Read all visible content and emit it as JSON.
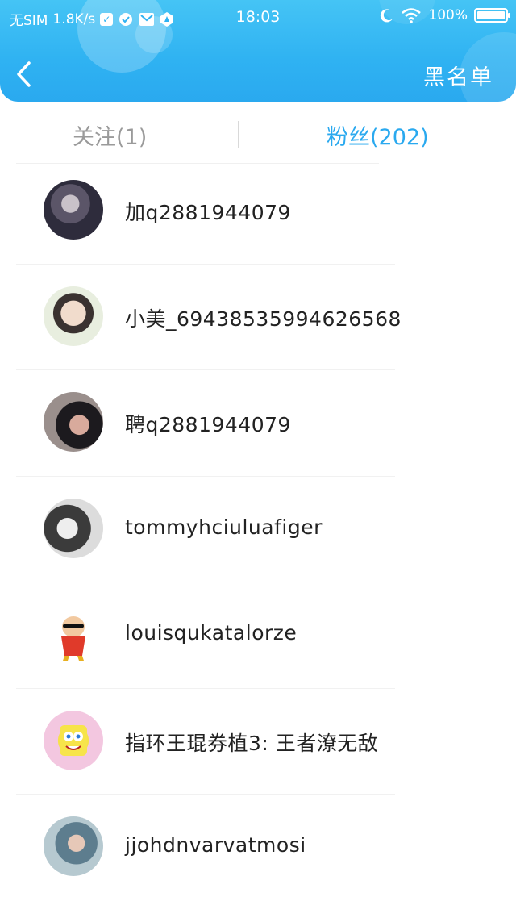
{
  "status_bar": {
    "carrier": "无SIM",
    "speed": "1.8K/s",
    "time": "18:03",
    "battery": "100%",
    "battery_level": 1.0
  },
  "header": {
    "back_icon": "chevron-left-icon",
    "blacklist_label": "黑名单",
    "accent_color": "#2fb2f2"
  },
  "tabs": [
    {
      "label": "关注(1)",
      "active": false
    },
    {
      "label": "粉丝(202)",
      "active": true
    }
  ],
  "fans": [
    {
      "name": "加q2881944079"
    },
    {
      "name": "小美_69438535994626568"
    },
    {
      "name": "聘q2881944079"
    },
    {
      "name": "tommyhciuluafiger"
    },
    {
      "name": "louisqukatalorze"
    },
    {
      "name": "指环王琨券植3: 王者潦无敌"
    },
    {
      "name": "jjohdnvarvatmosi"
    }
  ]
}
